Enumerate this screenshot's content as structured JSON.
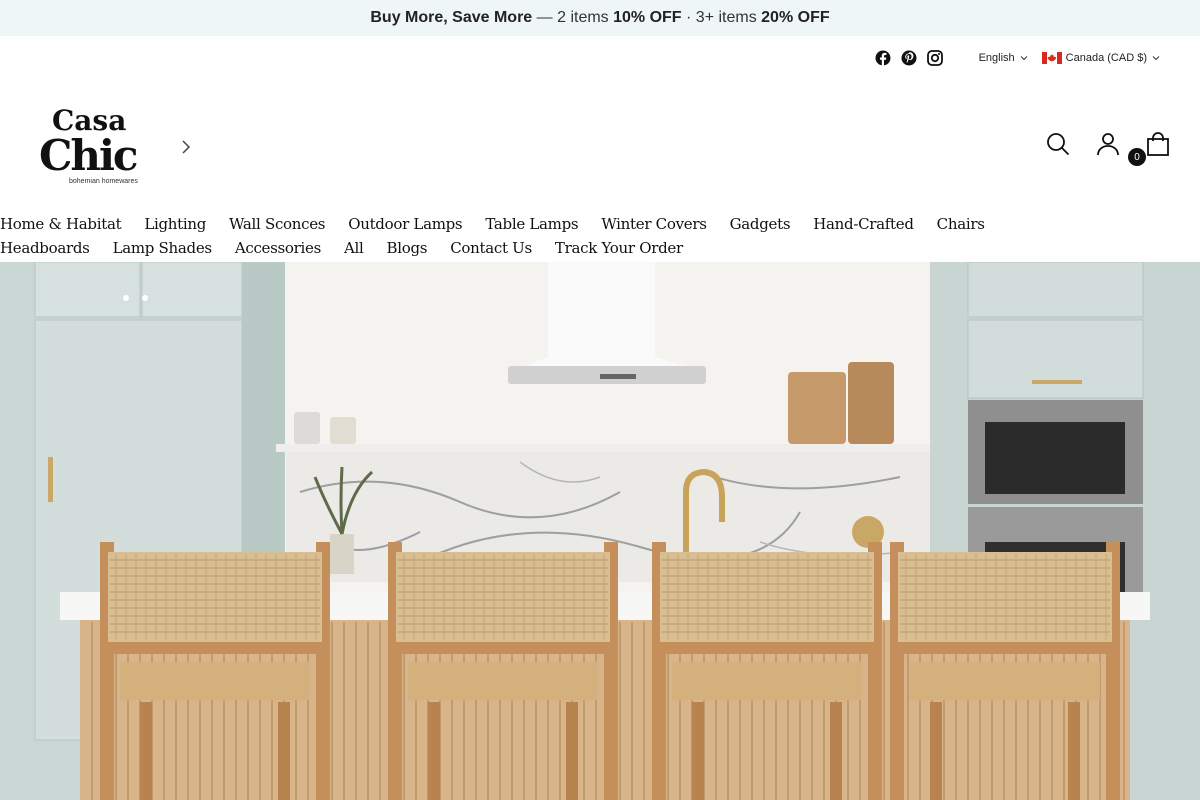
{
  "announcement": {
    "part1": "Buy More, Save More",
    "part2": " — 2 items ",
    "part3": "10% OFF",
    "part4": " · 3+ items ",
    "part5": "20% OFF"
  },
  "utility": {
    "social_icons": [
      "facebook-icon",
      "pinterest-icon",
      "instagram-icon"
    ],
    "language": "English",
    "currency": "Canada (CAD $)"
  },
  "header": {
    "logo_line1": "Casa",
    "logo_line2": "Chic",
    "logo_tagline": "bohemian homewares",
    "cart_count": "0"
  },
  "nav": {
    "row1": [
      "Home & Habitat",
      "Lighting",
      "Wall Sconces",
      "Outdoor Lamps",
      "Table Lamps",
      "Winter Covers",
      "Gadgets",
      "Hand-Crafted",
      "Chairs"
    ],
    "row2": [
      "Headboards",
      "Lamp Shades",
      "Accessories",
      "All",
      "Blogs",
      "Contact Us",
      "Track Your Order"
    ]
  },
  "colors": {
    "announce_bg": "#eef7f6",
    "cabinet": "#c9d9d6",
    "wood": "#d4a574"
  }
}
